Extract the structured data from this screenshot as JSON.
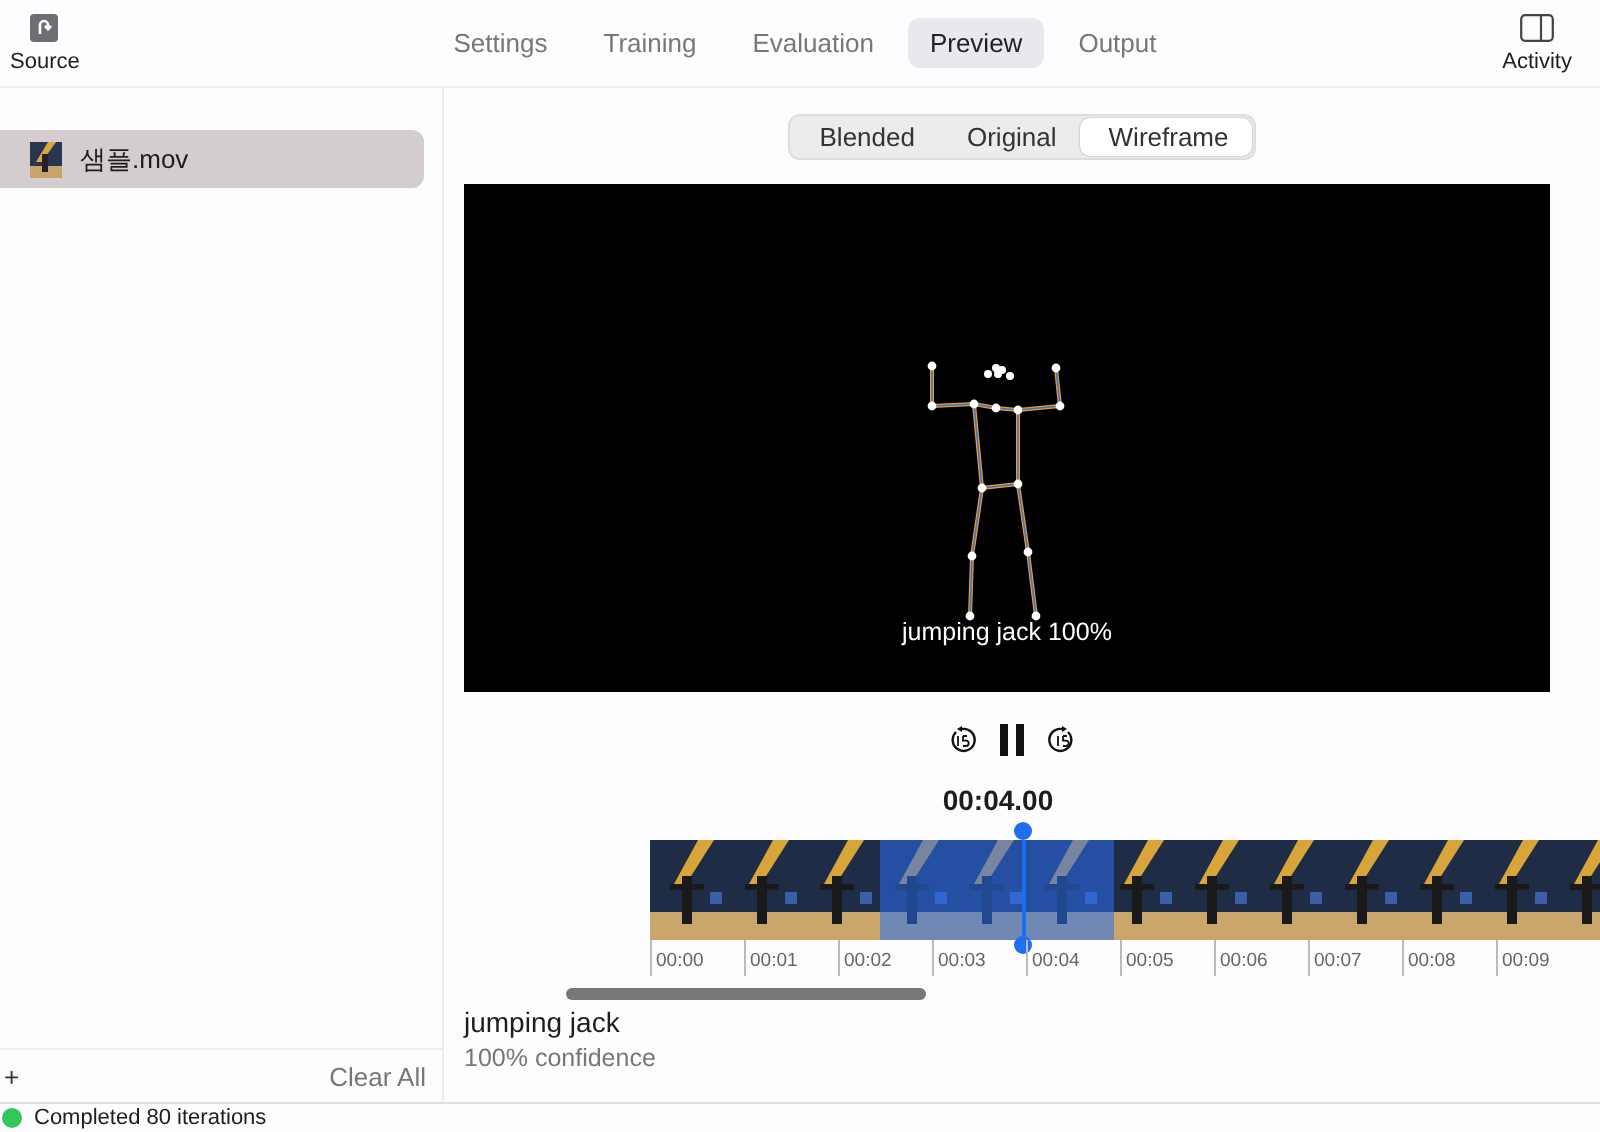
{
  "toolbar": {
    "source_label": "Source",
    "activity_label": "Activity",
    "tabs": [
      {
        "label": "Settings",
        "selected": false
      },
      {
        "label": "Training",
        "selected": false
      },
      {
        "label": "Evaluation",
        "selected": false
      },
      {
        "label": "Preview",
        "selected": true
      },
      {
        "label": "Output",
        "selected": false
      }
    ]
  },
  "sidebar": {
    "items": [
      {
        "name": "샘플.mov",
        "selected": true
      }
    ],
    "add_button": "+",
    "clear_button": "Clear All"
  },
  "preview": {
    "view_modes": [
      {
        "label": "Blended",
        "selected": false
      },
      {
        "label": "Original",
        "selected": false
      },
      {
        "label": "Wireframe",
        "selected": true
      }
    ],
    "overlay_caption": "jumping jack 100%",
    "playing": true,
    "time": "00:04.00",
    "ticks": [
      "00:00",
      "00:01",
      "00:02",
      "00:03",
      "00:04",
      "00:05",
      "00:06",
      "00:07",
      "00:08",
      "00:09"
    ]
  },
  "prediction": {
    "label": "jumping jack",
    "confidence": "100% confidence"
  },
  "status_bar": {
    "text": "Completed 80 iterations"
  }
}
